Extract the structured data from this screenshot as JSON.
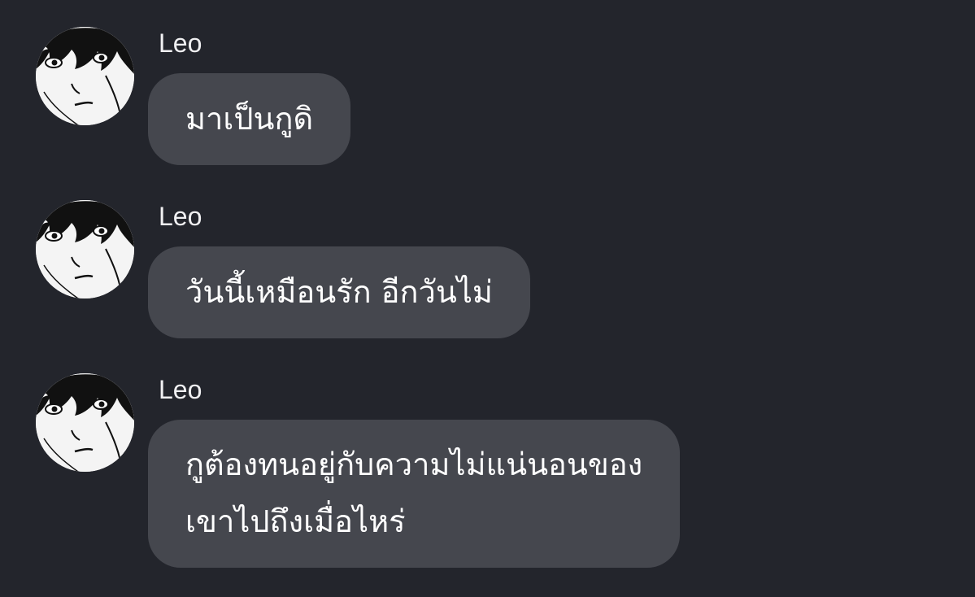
{
  "messages": [
    {
      "sender": "Leo",
      "avatar_icon": "anime-face-avatar-icon",
      "lines": [
        "มาเป็นกูดิ"
      ]
    },
    {
      "sender": "Leo",
      "avatar_icon": "anime-face-avatar-icon",
      "lines": [
        "วันนี้เหมือนรัก อีกวันไม่"
      ]
    },
    {
      "sender": "Leo",
      "avatar_icon": "anime-face-avatar-icon",
      "lines": [
        "กูต้องทนอยู่กับความไม่แน่นอนของ",
        "เขาไปถึงเมื่อไหร่"
      ]
    }
  ],
  "colors": {
    "background": "#23252c",
    "bubble": "#45474e",
    "text": "#ffffff"
  }
}
